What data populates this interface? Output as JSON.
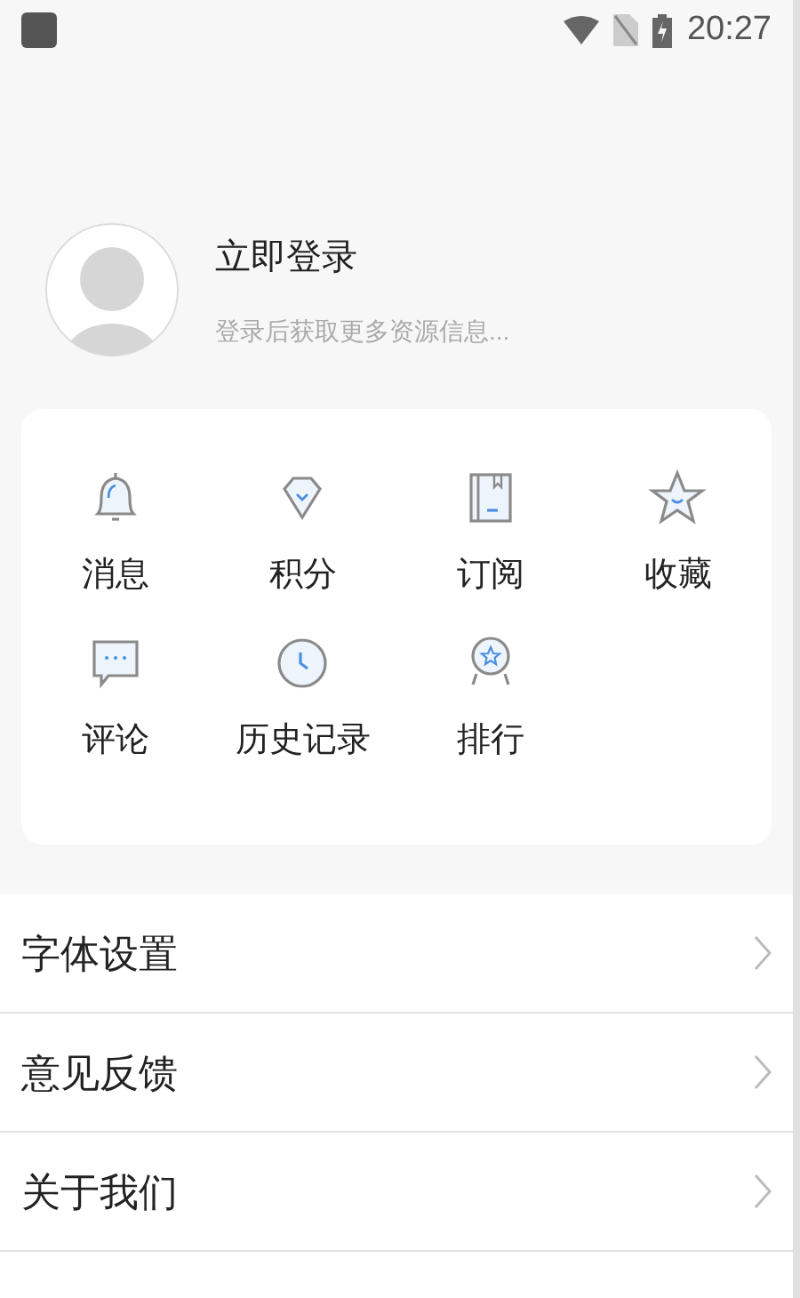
{
  "status_bar": {
    "time": "20:27"
  },
  "profile": {
    "title": "立即登录",
    "subtitle": "登录后获取更多资源信息..."
  },
  "shortcuts": [
    {
      "label": "消息"
    },
    {
      "label": "积分"
    },
    {
      "label": "订阅"
    },
    {
      "label": "收藏"
    },
    {
      "label": "评论"
    },
    {
      "label": "历史记录"
    },
    {
      "label": "排行"
    }
  ],
  "menu": [
    {
      "label": "字体设置"
    },
    {
      "label": "意见反馈"
    },
    {
      "label": "关于我们"
    }
  ]
}
